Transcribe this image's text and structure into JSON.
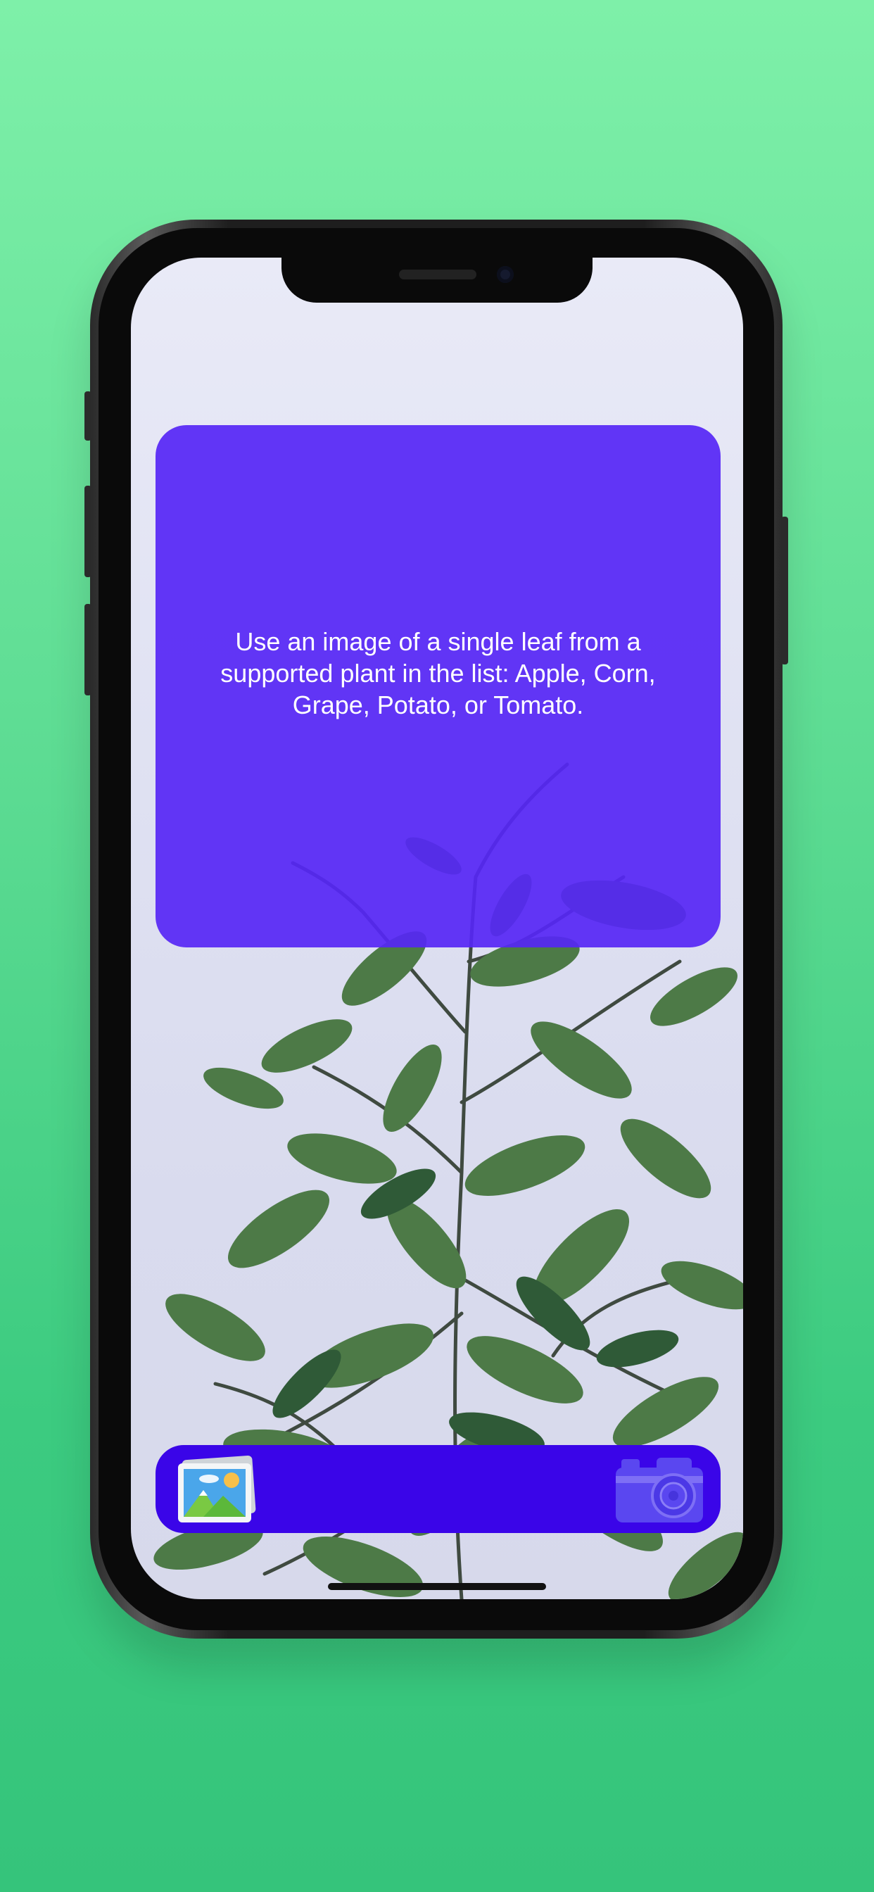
{
  "info_card": {
    "message": "Use an image of a single leaf from a supported plant in the list: Apple, Corn, Grape, Potato, or Tomato."
  },
  "toolbar": {
    "photo_library_icon": "photo-library-icon",
    "camera_icon": "camera-icon"
  },
  "colors": {
    "card": "#5626F5",
    "toolbar": "#3A05E8",
    "background": "#4FD68B"
  }
}
